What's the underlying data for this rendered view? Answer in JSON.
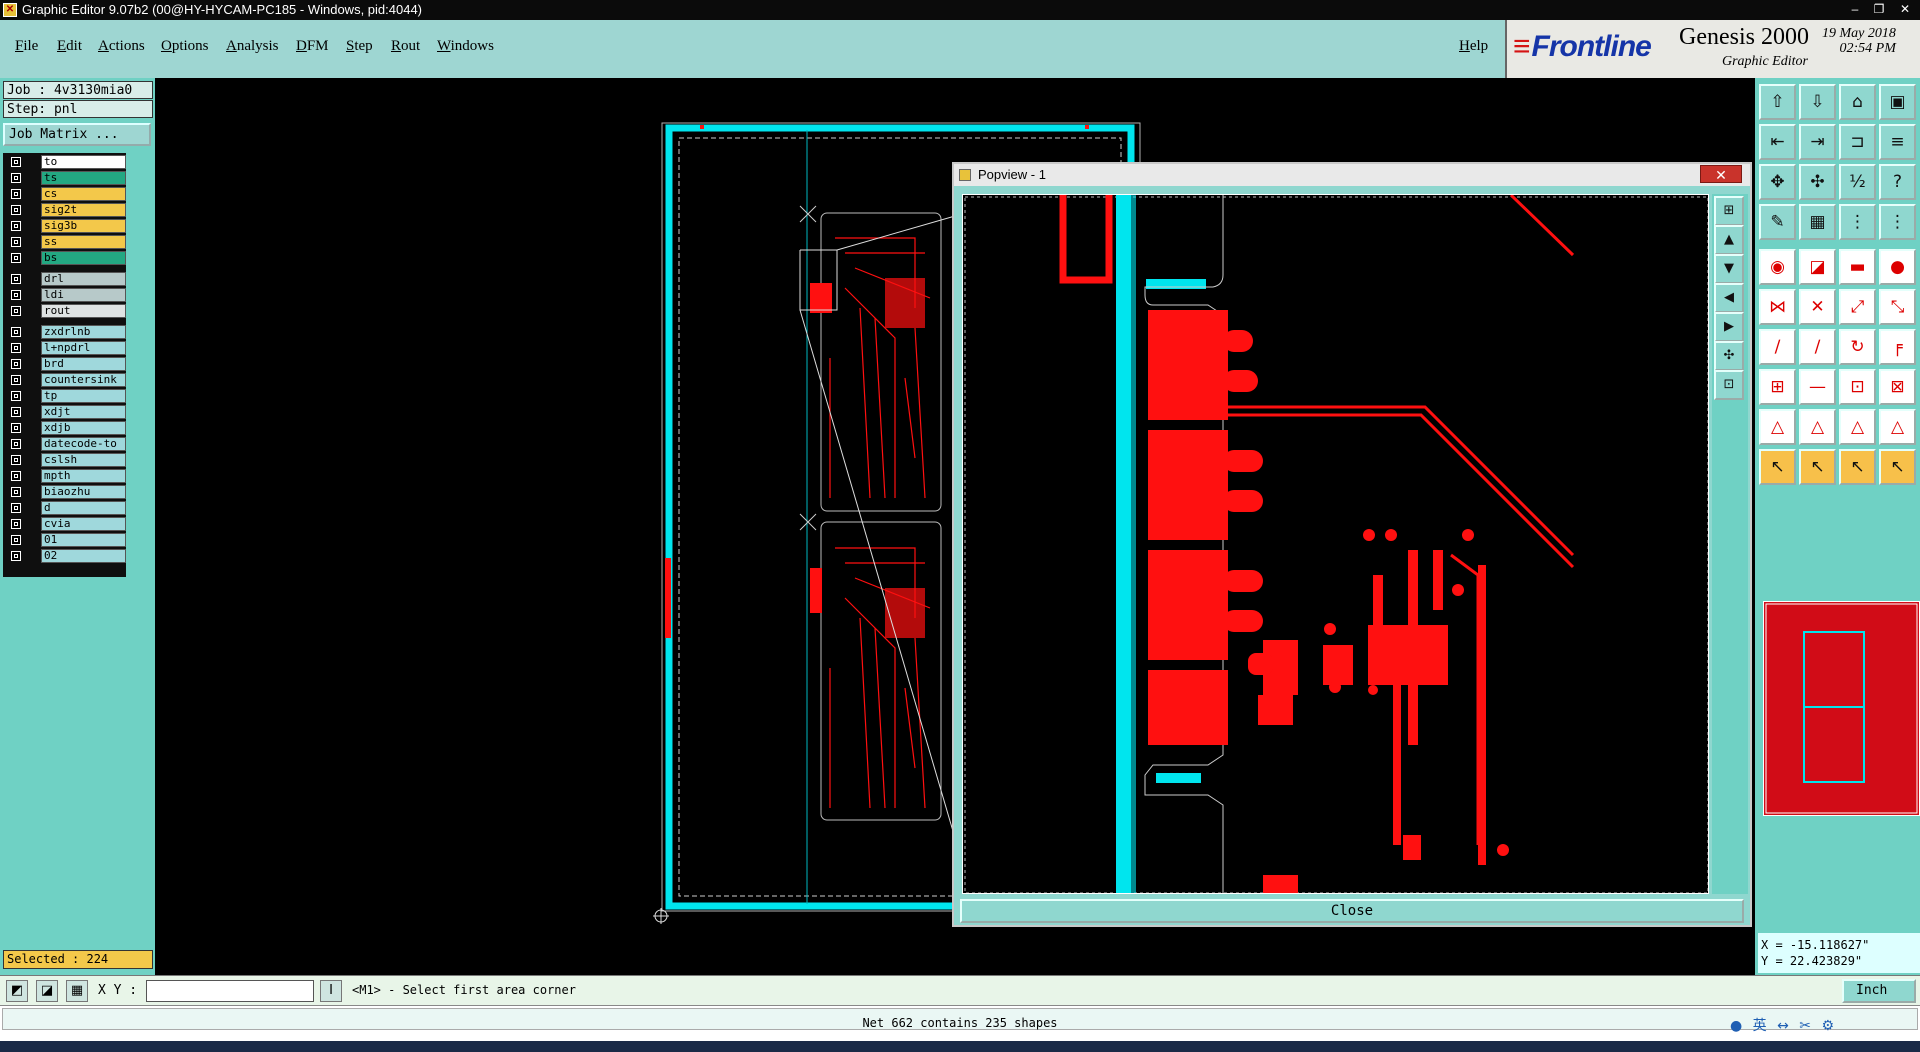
{
  "window": {
    "title": "Graphic Editor 9.07b2 (00@HY-HYCAM-PC185 - Windows, pid:4044)",
    "controls": [
      "–",
      "❐",
      "✕"
    ]
  },
  "menu": {
    "items": [
      "File",
      "Edit",
      "Actions",
      "Options",
      "Analysis",
      "DFM",
      "Step",
      "Rout",
      "Windows"
    ],
    "help": "Help"
  },
  "brand": {
    "logo": "Frontline",
    "product": "Genesis 2000",
    "subtitle": "Graphic Editor",
    "date": "19 May 2018",
    "time": "02:54 PM"
  },
  "job": {
    "job": "Job : 4v3130mia0",
    "step": "Step: pnl",
    "matrix_button": "Job Matrix ..."
  },
  "layers": [
    {
      "name": "to",
      "color": "#ffffff"
    },
    {
      "name": "ts",
      "color": "#23a882"
    },
    {
      "name": "cs",
      "color": "#f3c84a"
    },
    {
      "name": "sig2t",
      "color": "#f3c84a"
    },
    {
      "name": "sig3b",
      "color": "#f3c84a"
    },
    {
      "name": "ss",
      "color": "#f3c84a"
    },
    {
      "name": "bs",
      "color": "#23a882"
    },
    {
      "name": "drl",
      "color": "#b7c9c9"
    },
    {
      "name": "ldi",
      "color": "#b7c9c9"
    },
    {
      "name": "rout",
      "color": "#dfe3e3"
    },
    {
      "name": "zxdrlnb",
      "color": "#9fd8dc"
    },
    {
      "name": "l+npdrl",
      "color": "#9fd8dc"
    },
    {
      "name": "brd",
      "color": "#9fd8dc"
    },
    {
      "name": "countersink",
      "color": "#9fd8dc"
    },
    {
      "name": "tp",
      "color": "#9fd8dc"
    },
    {
      "name": "xdjt",
      "color": "#9fd8dc"
    },
    {
      "name": "xdjb",
      "color": "#9fd8dc"
    },
    {
      "name": "datecode-to",
      "color": "#9fd8dc"
    },
    {
      "name": "cslsh",
      "color": "#9fd8dc"
    },
    {
      "name": "mpth",
      "color": "#9fd8dc"
    },
    {
      "name": "biaozhu",
      "color": "#9fd8dc"
    },
    {
      "name": "d",
      "color": "#9fd8dc"
    },
    {
      "name": "cvia",
      "color": "#9fd8dc"
    },
    {
      "name": "01",
      "color": "#9fd8dc"
    },
    {
      "name": "02",
      "color": "#9fd8dc"
    }
  ],
  "selected": "Selected : 224",
  "popview": {
    "title": "Popview - 1",
    "close_x": "✕",
    "close_button": "Close"
  },
  "coords": {
    "x": "X = -15.118627\"",
    "y": "Y = 22.423829\""
  },
  "command": {
    "xy_label": "X Y :",
    "xy_value": "",
    "prompt": "<M1> - Select first area corner",
    "unit": "Inch"
  },
  "status": "Net 662 contains 235 shapes",
  "colors": {
    "panel": "#6fd1c4",
    "menu": "#9ed6d2",
    "copper": "#ff0000",
    "outline": "#00e5ee"
  }
}
